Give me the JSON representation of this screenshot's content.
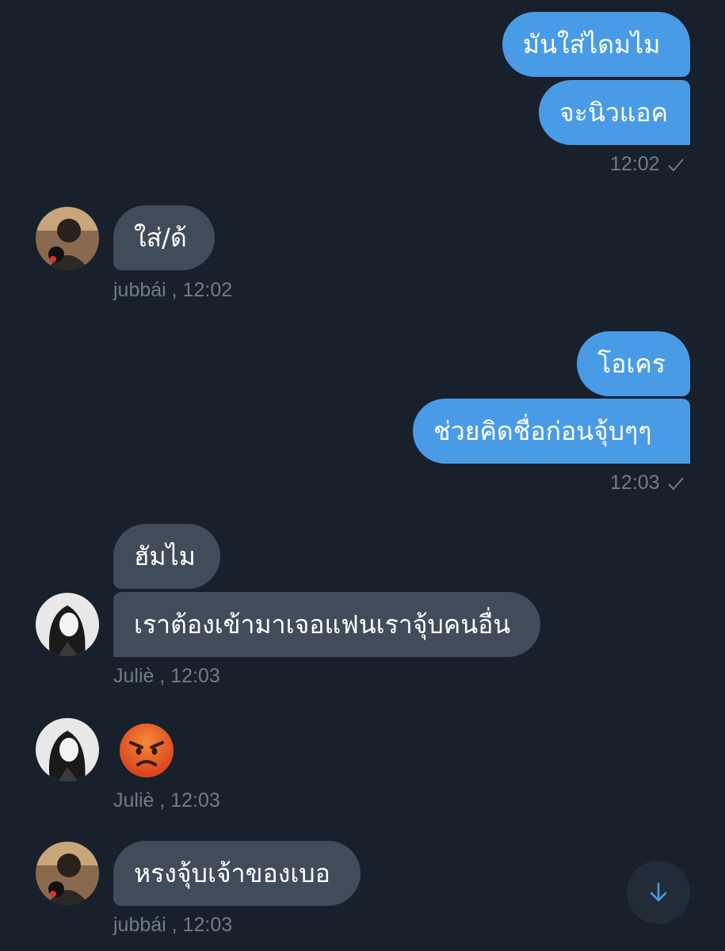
{
  "messages": {
    "m1": "มันใส่ไดมไม",
    "m2": "จะนิวแอค",
    "m3": "ใส่/ด้",
    "m4": "โอเคร",
    "m5": "ช่วยคิดชื่อก่อนจุ้บๆๆ",
    "m6": "ฮัมไม",
    "m7": "เราต้องเข้ามาเจอแฟนเราจุ้บคนอื่น",
    "m8_emoji": "angry-face",
    "m9": "หรงจุ้บเจ้าของเบอ"
  },
  "meta": {
    "out1_time": "12:02",
    "in1": "jubbái  , 12:02",
    "out2_time": "12:03",
    "in2": "Juliè  , 12:03",
    "in3": "Juliè  , 12:03",
    "in4": "jubbái  , 12:03"
  },
  "icons": {
    "sent": "check-icon",
    "scroll": "arrow-down-icon"
  },
  "colors": {
    "background": "#18202b",
    "outgoing": "#4a9be6",
    "incoming": "#404c5a",
    "meta_text": "#6e7c8b",
    "accent": "#4a9be6"
  }
}
